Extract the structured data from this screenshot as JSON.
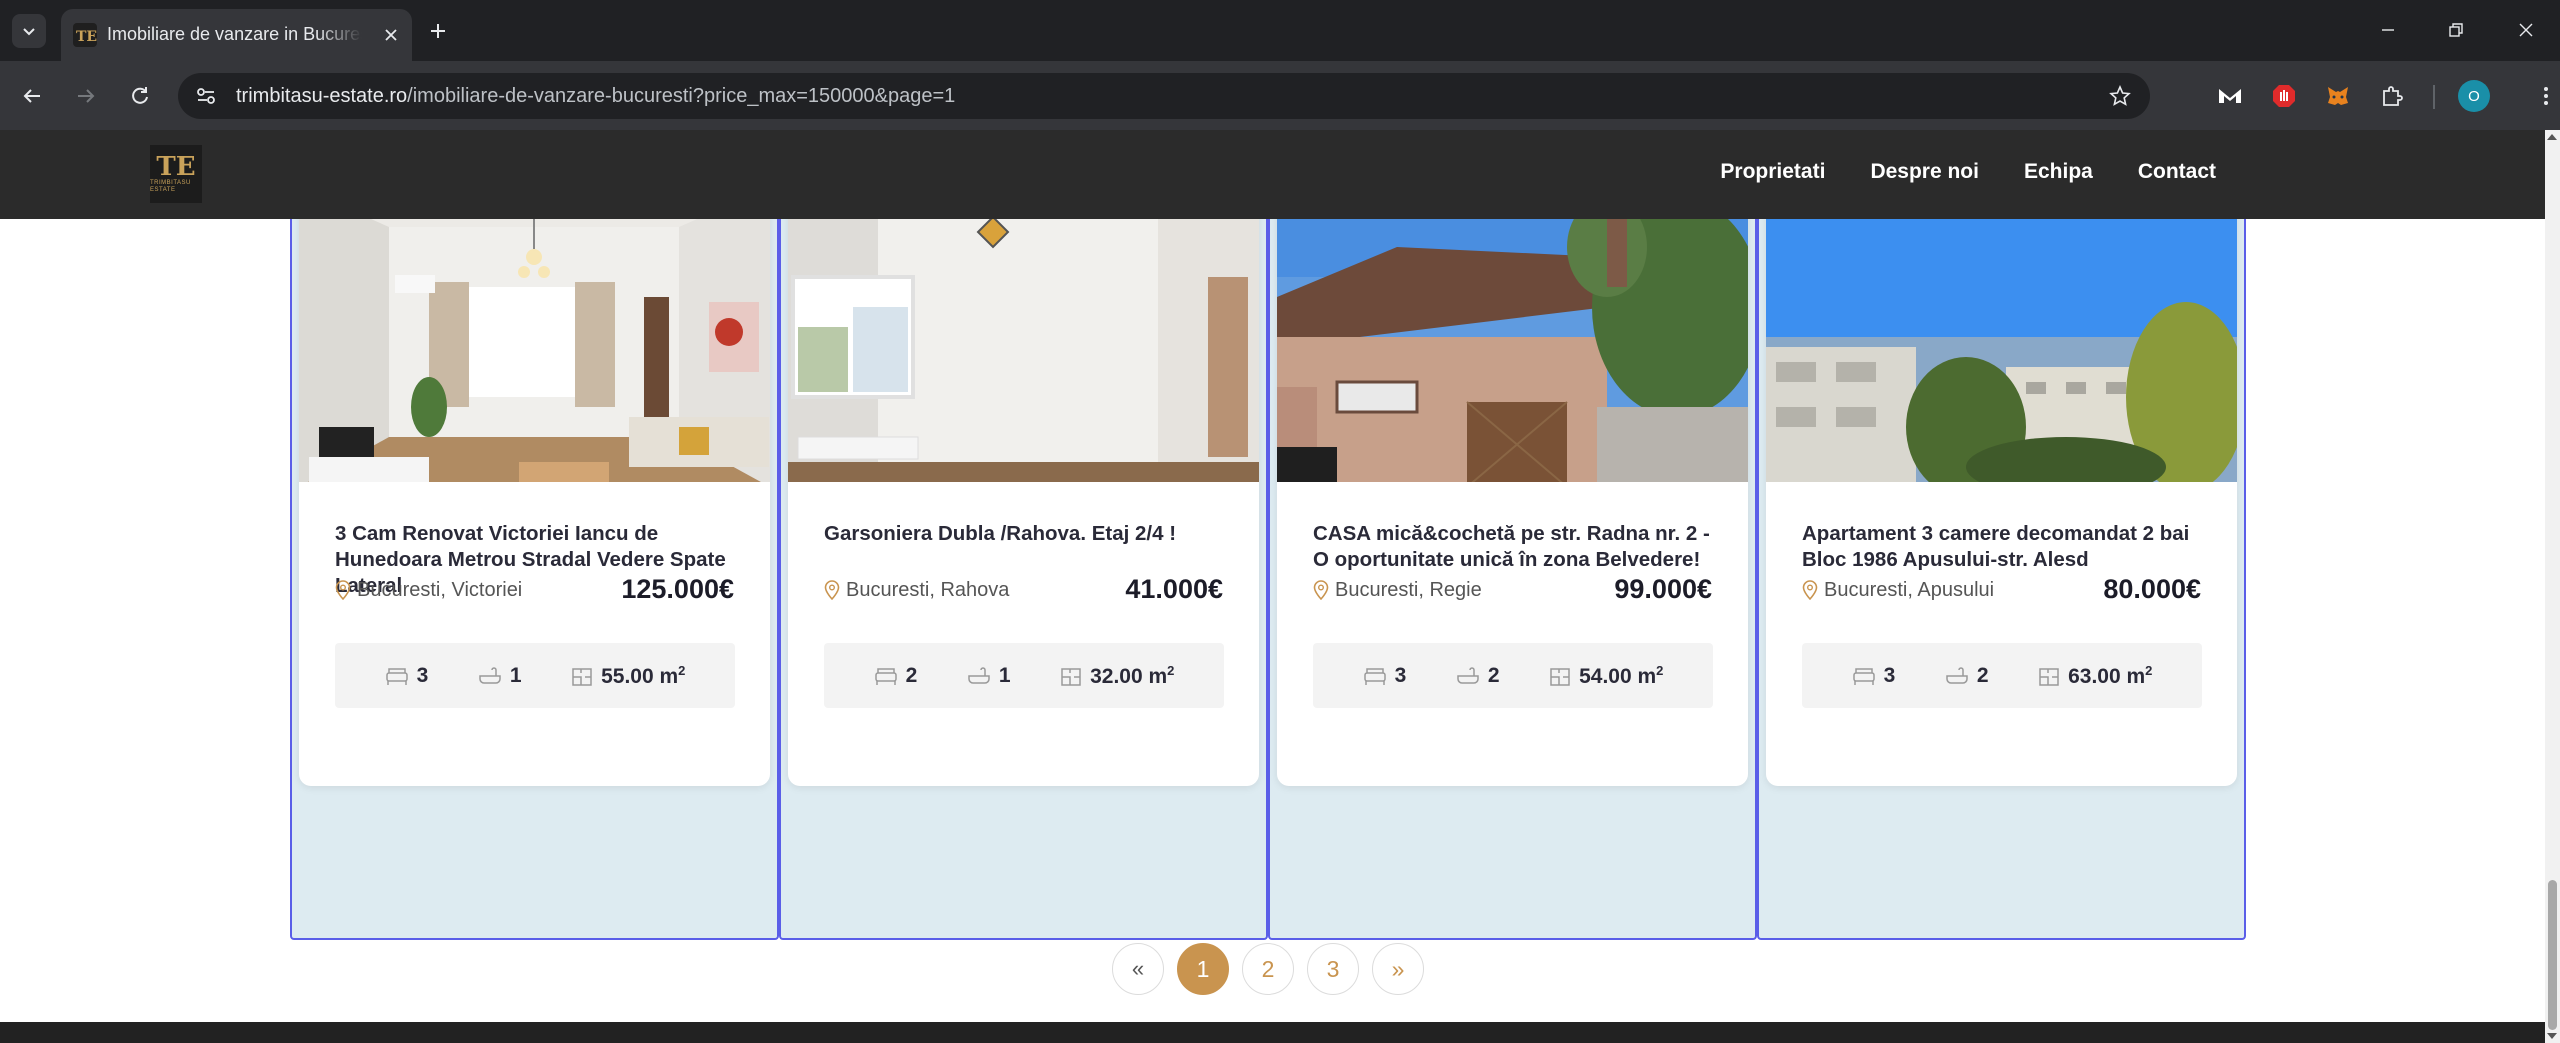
{
  "browser": {
    "tab_title": "Imobiliare de vanzare in Bucuresti",
    "url_host": "trimbitasu-estate.ro",
    "url_path": "/imobiliare-de-vanzare-bucuresti?price_max=150000&page=1",
    "profile_initial": "O"
  },
  "site": {
    "logo_mark": "TE",
    "logo_sub": "TRIMBITASU ESTATE",
    "nav": [
      "Proprietati",
      "Despre noi",
      "Echipa",
      "Contact"
    ]
  },
  "listings": [
    {
      "title": "3 Cam Renovat Victoriei Iancu de Hunedoara Metrou Stradal Vedere Spate Lateral",
      "location": "Bucuresti, Victoriei",
      "price": "125.000€",
      "rooms": "3",
      "baths": "1",
      "area": "55.00 m",
      "image": "living-room-interior"
    },
    {
      "title": "Garsoniera Dubla /Rahova. Etaj 2/4 !",
      "location": "Bucuresti, Rahova",
      "price": "41.000€",
      "rooms": "2",
      "baths": "1",
      "area": "32.00 m",
      "image": "empty-room-interior"
    },
    {
      "title": "CASA mică&cochetă pe str. Radna nr. 2 - O oportunitate unică în zona Belvedere!",
      "location": "Bucuresti, Regie",
      "price": "99.000€",
      "rooms": "3",
      "baths": "2",
      "area": "54.00 m",
      "image": "house-exterior"
    },
    {
      "title": "Apartament 3 camere decomandat 2 bai Bloc 1986 Apusului-str. Alesd",
      "location": "Bucuresti, Apusului",
      "price": "80.000€",
      "rooms": "3",
      "baths": "2",
      "area": "63.00 m",
      "image": "apartment-block-exterior"
    }
  ],
  "area_unit_sup": "2",
  "pagination": {
    "prev": "«",
    "pages": [
      "1",
      "2",
      "3"
    ],
    "active": "1",
    "next": "»"
  },
  "colors": {
    "accent": "#c9944f",
    "column_border": "#5a5ee8",
    "column_bg": "#ddebf1",
    "header_bg": "#2b2b2b"
  }
}
